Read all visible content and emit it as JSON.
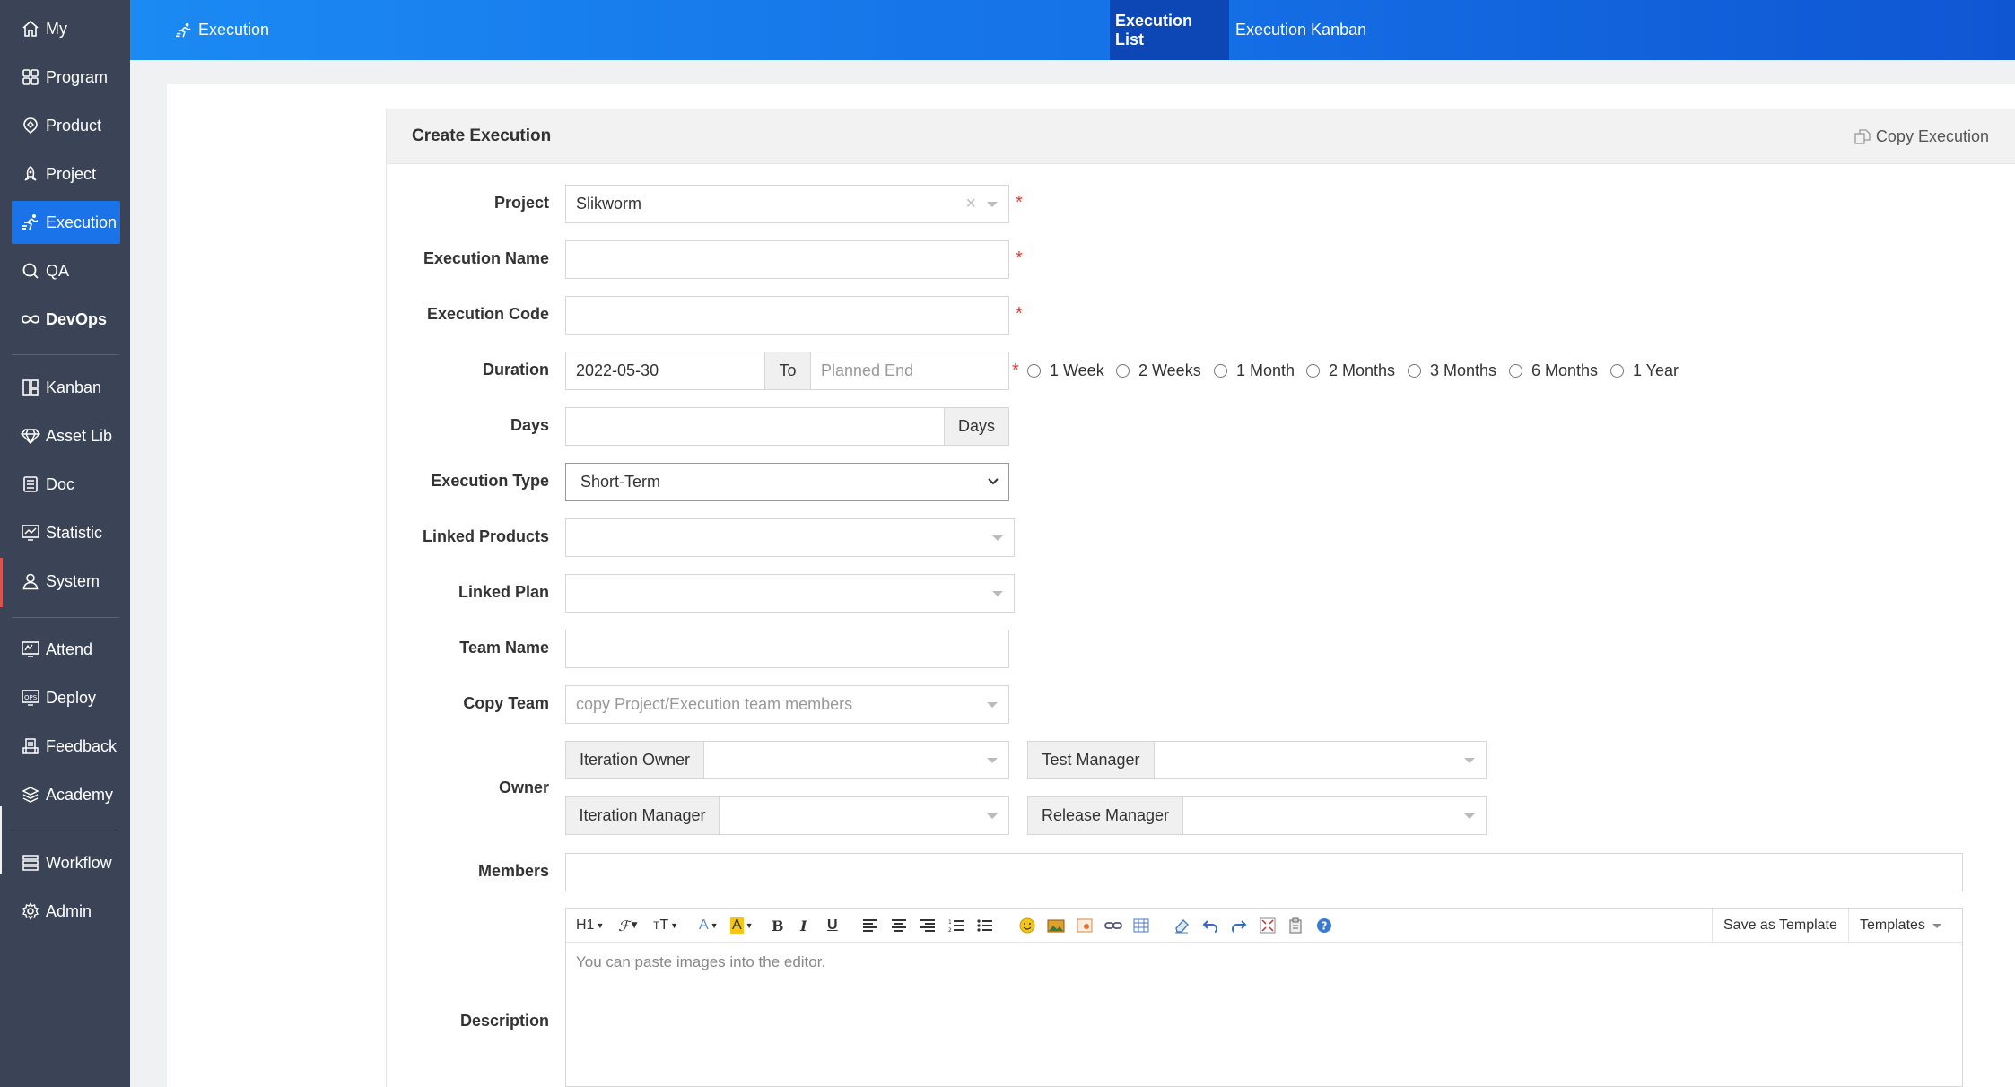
{
  "sidebar": {
    "items": [
      {
        "label": "My",
        "icon": "home-icon"
      },
      {
        "label": "Program",
        "icon": "grid-icon"
      },
      {
        "label": "Product",
        "icon": "product-icon"
      },
      {
        "label": "Project",
        "icon": "rocket-icon"
      },
      {
        "label": "Execution",
        "icon": "run-icon"
      },
      {
        "label": "QA",
        "icon": "magnifier-icon"
      },
      {
        "label": "DevOps",
        "icon": "infinity-icon"
      },
      {
        "label": "Kanban",
        "icon": "kanban-icon"
      },
      {
        "label": "Asset Lib",
        "icon": "diamond-icon"
      },
      {
        "label": "Doc",
        "icon": "document-icon"
      },
      {
        "label": "Statistic",
        "icon": "chart-icon"
      },
      {
        "label": "System",
        "icon": "user-icon"
      },
      {
        "label": "Attend",
        "icon": "attend-icon"
      },
      {
        "label": "Deploy",
        "icon": "deploy-icon"
      },
      {
        "label": "Feedback",
        "icon": "feedback-icon"
      },
      {
        "label": "Academy",
        "icon": "academy-icon"
      },
      {
        "label": "Workflow",
        "icon": "workflow-icon"
      },
      {
        "label": "Admin",
        "icon": "gear-icon"
      }
    ]
  },
  "header": {
    "breadcrumb": "Execution",
    "tabs": [
      {
        "label": "Execution List"
      },
      {
        "label": "Execution Kanban"
      }
    ]
  },
  "form": {
    "title": "Create Execution",
    "copy_label": "Copy Execution",
    "labels": {
      "project": "Project",
      "execution_name": "Execution Name",
      "execution_code": "Execution Code",
      "duration": "Duration",
      "days": "Days",
      "execution_type": "Execution Type",
      "linked_products": "Linked Products",
      "linked_plan": "Linked Plan",
      "team_name": "Team Name",
      "copy_team": "Copy Team",
      "owner": "Owner",
      "members": "Members",
      "description": "Description"
    },
    "project_value": "Slikworm",
    "duration_begin": "2022-05-30",
    "duration_to": "To",
    "duration_end_placeholder": "Planned End",
    "days_addon": "Days",
    "execution_type_value": "Short-Term",
    "copy_team_placeholder": "copy Project/Execution team members",
    "owner_roles": {
      "iteration_owner": "Iteration Owner",
      "test_manager": "Test Manager",
      "iteration_manager": "Iteration Manager",
      "release_manager": "Release Manager"
    },
    "duration_options": [
      "1 Week",
      "2 Weeks",
      "1 Month",
      "2 Months",
      "3 Months",
      "6 Months",
      "1 Year"
    ],
    "required_mark": "*"
  },
  "editor": {
    "heading_btn": "H1",
    "save_template": "Save as Template",
    "templates": "Templates",
    "placeholder": "You can paste images into the editor."
  },
  "colors": {
    "sidebar_bg": "#3b4456",
    "accent": "#1a73e8",
    "required": "#e53935"
  }
}
